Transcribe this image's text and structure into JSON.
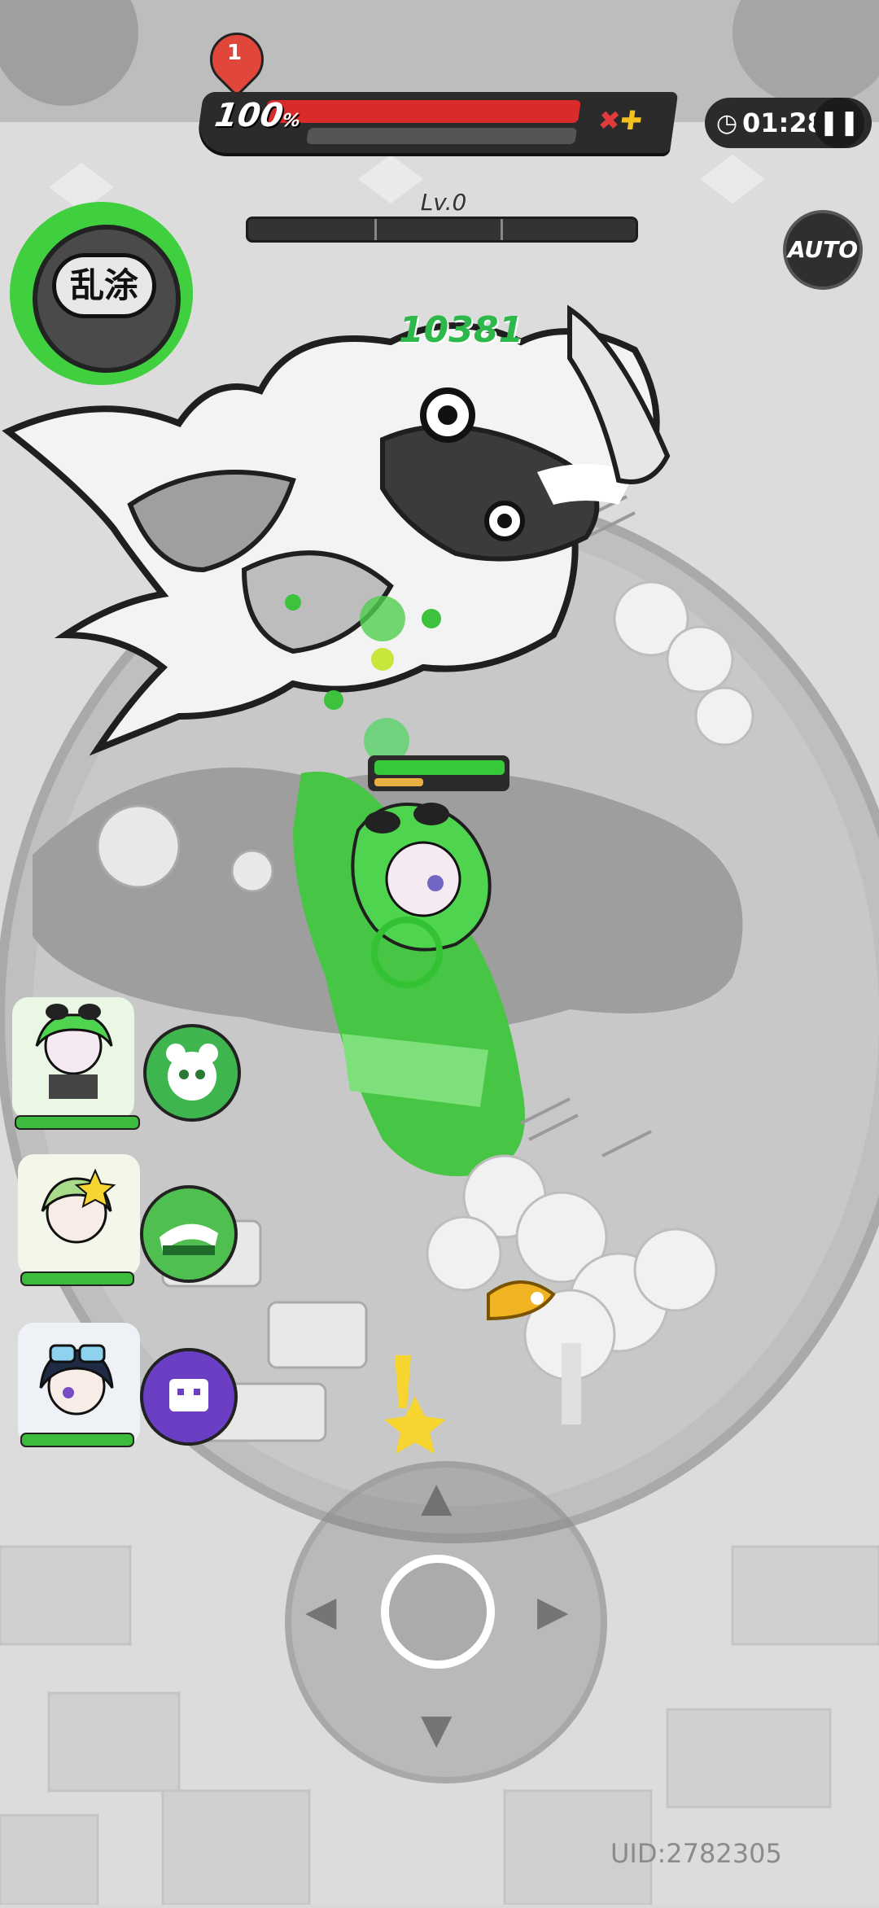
{
  "hud": {
    "boss_hp_percent": "100",
    "boss_hp_unit": "%",
    "lives": "1",
    "timer": "01:28",
    "level_label": "Lv.0",
    "auto_label": "AUTO",
    "skill_label": "乱涂",
    "damage_number": "10381"
  },
  "colors": {
    "accent_green": "#3fcf3f",
    "boss_hp_red": "#d92b2b",
    "hud_dark": "#2b2b2b"
  },
  "party": [
    {
      "name": "green-hair-character",
      "skill_icon": "panda-icon",
      "skill_color": "#3fb54f"
    },
    {
      "name": "star-hat-character",
      "skill_icon": "sweep-icon",
      "skill_color": "#4fbf4f"
    },
    {
      "name": "goggles-character",
      "skill_icon": "robot-icon",
      "skill_color": "#6a3fc4"
    }
  ],
  "footer": {
    "uid": "UID:2782305"
  }
}
